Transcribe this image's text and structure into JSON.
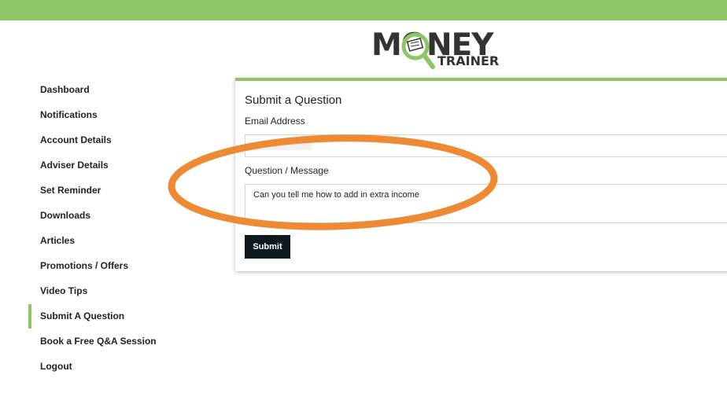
{
  "brand": {
    "logo_word": "MONEY",
    "logo_sub": "TRAINER",
    "accent_color": "#8dc665"
  },
  "sidebar": {
    "items": [
      {
        "label": "Dashboard",
        "active": false
      },
      {
        "label": "Notifications",
        "active": false
      },
      {
        "label": "Account Details",
        "active": false
      },
      {
        "label": "Adviser Details",
        "active": false
      },
      {
        "label": "Set Reminder",
        "active": false
      },
      {
        "label": "Downloads",
        "active": false
      },
      {
        "label": "Articles",
        "active": false
      },
      {
        "label": "Promotions / Offers",
        "active": false
      },
      {
        "label": "Video Tips",
        "active": false
      },
      {
        "label": "Submit A Question",
        "active": true
      },
      {
        "label": "Book a Free Q&A Session",
        "active": false
      },
      {
        "label": "Logout",
        "active": false
      }
    ]
  },
  "form": {
    "title": "Submit a Question",
    "email_label": "Email Address",
    "email_value": "",
    "message_label": "Question / Message",
    "message_value": "Can you tell me how to add in extra income",
    "submit_label": "Submit"
  },
  "annotation": {
    "shape": "ellipse",
    "color": "#ee8a33"
  }
}
